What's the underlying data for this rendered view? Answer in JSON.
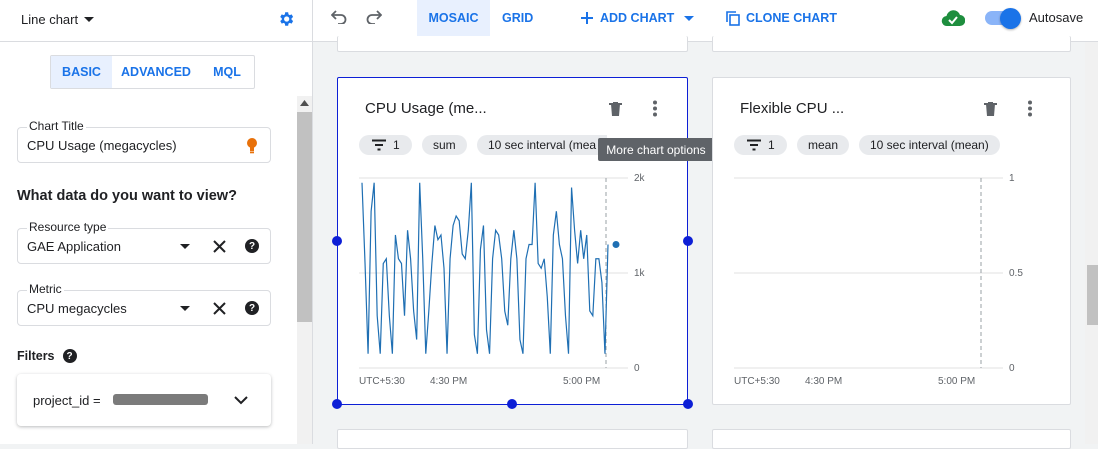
{
  "left_panel": {
    "chart_type": "Line chart",
    "tabs": [
      "BASIC",
      "ADVANCED",
      "MQL"
    ],
    "chart_title_label": "Chart Title",
    "chart_title_value": "CPU Usage (megacycles)",
    "section_title": "What data do you want to view?",
    "resource_type_label": "Resource type",
    "resource_type_value": "GAE Application",
    "metric_label": "Metric",
    "metric_value": "CPU megacycles",
    "filters_label": "Filters",
    "filter_text": "project_id ="
  },
  "toolbar": {
    "mosaic": "MOSAIC",
    "grid": "GRID",
    "add_chart": "ADD CHART",
    "clone_chart": "CLONE CHART",
    "autosave": "Autosave"
  },
  "cards": {
    "cpu": {
      "title": "CPU Usage (me...",
      "chips": [
        "1",
        "sum",
        "10 sec interval (mea"
      ],
      "tooltip": "More chart options",
      "y_ticks": [
        "2k",
        "1k",
        "0"
      ],
      "x_ticks": [
        "UTC+5:30",
        "4:30 PM",
        "5:00 PM"
      ]
    },
    "flex": {
      "title": "Flexible CPU ...",
      "chips": [
        "1",
        "mean",
        "10 sec interval (mean)"
      ],
      "y_ticks": [
        "1",
        "0.5",
        "0"
      ],
      "x_ticks": [
        "UTC+5:30",
        "4:30 PM",
        "5:00 PM"
      ]
    }
  },
  "colors": {
    "accent": "#1a73e8",
    "line": "#1f6fb3",
    "selection": "#0d1fd6",
    "ok_green": "#1e8e3e"
  },
  "chart_data": [
    {
      "type": "line",
      "title": "CPU Usage (me...",
      "y_ticks": [
        "0",
        "1k",
        "2k"
      ],
      "ylim": [
        0,
        2000
      ],
      "x_ticks": [
        "UTC+5:30",
        "4:30 PM",
        "5:00 PM"
      ],
      "series": [
        {
          "values": [
            1950,
            1100,
            150,
            1650,
            1950,
            550,
            150,
            1100,
            1150,
            550,
            150,
            1400,
            1150,
            1100,
            550,
            1450,
            1150,
            600,
            300,
            1950,
            1150,
            150,
            600,
            1100,
            1500,
            1350,
            1400,
            1050,
            150,
            1150,
            1500,
            1600,
            1550,
            1200,
            1150,
            1450,
            1950,
            350,
            150,
            1250,
            1500,
            400,
            150,
            1150,
            1450,
            1400,
            1150,
            600,
            450,
            1150,
            1450,
            1150,
            300,
            150,
            1150,
            1300,
            1300,
            1950,
            1100,
            1050,
            1150,
            750,
            150,
            1400,
            1650,
            1300,
            1150,
            550,
            150,
            1900,
            1450,
            1100,
            1450,
            1150,
            1400,
            600,
            550,
            1150,
            1150,
            900,
            150,
            1300
          ]
        }
      ],
      "last_point": 1300
    },
    {
      "type": "line",
      "title": "Flexible CPU ...",
      "y_ticks": [
        "0",
        "0.5",
        "1"
      ],
      "ylim": [
        0,
        1
      ],
      "x_ticks": [
        "UTC+5:30",
        "4:30 PM",
        "5:00 PM"
      ],
      "series": []
    }
  ]
}
